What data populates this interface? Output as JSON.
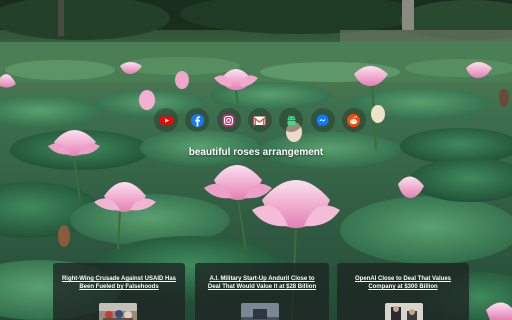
{
  "center_title": "beautiful roses arrangement",
  "shortcuts": [
    {
      "icon": "youtube-icon",
      "color": "#ff0000"
    },
    {
      "icon": "facebook-icon",
      "color": "#1877f2"
    },
    {
      "icon": "instagram-icon",
      "color": "#dd2a7b"
    },
    {
      "icon": "gmail-icon",
      "color": "#ea4335"
    },
    {
      "icon": "android-icon",
      "color": "#3ddc84"
    },
    {
      "icon": "messenger-icon",
      "color": "#0084ff"
    },
    {
      "icon": "reddit-icon",
      "color": "#ff4500"
    }
  ],
  "news": [
    {
      "headline": "Right-Wing Crusade Against USAID Has Been Fueled by Falsehoods"
    },
    {
      "headline": "A.I. Military Start-Up Anduril Close to Deal That Would Value It at $28 Billion"
    },
    {
      "headline": "OpenAI Close to Deal That Values Company at $300 Billion"
    }
  ]
}
